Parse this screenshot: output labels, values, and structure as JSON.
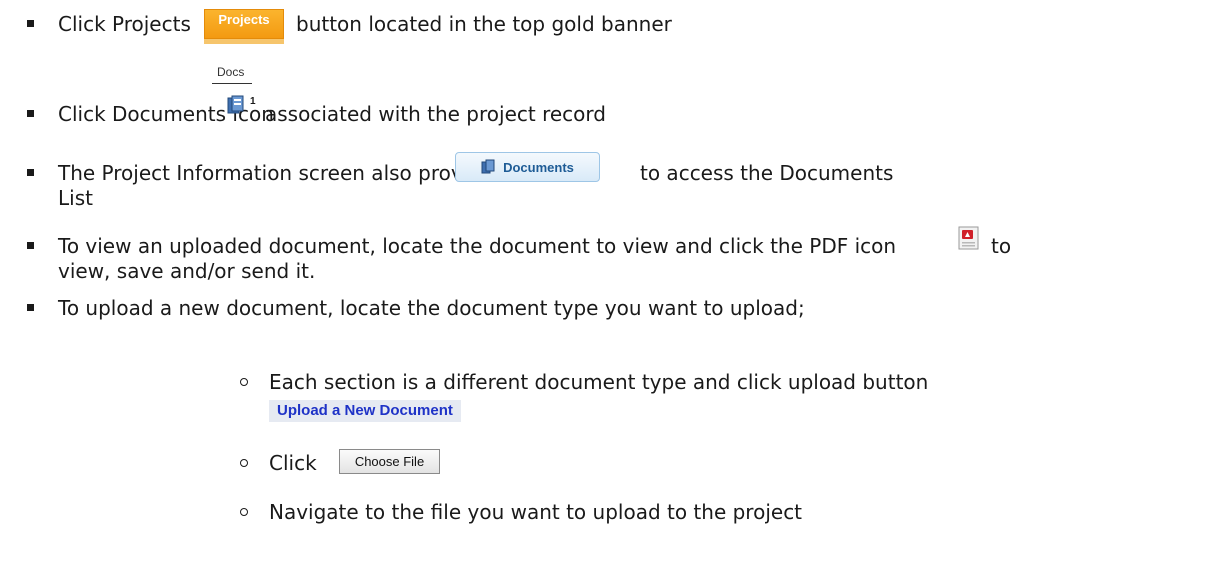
{
  "items": [
    {
      "pre": "Click Projects",
      "post": "button located in the top gold banner"
    },
    {
      "pre": "Click Documents icon",
      "post": "associated with the project record"
    },
    {
      "pre": "The Project Information screen also provides a button",
      "post": "to access the Documents",
      "line2": "List"
    },
    {
      "pre": "To view an uploaded document, locate the document to view and click the PDF icon",
      "post": "to",
      "line2": "view, save and/or send it."
    },
    {
      "pre": "To upload a new document, locate the document type you want to upload;"
    }
  ],
  "subitems": [
    {
      "text": "Each section is a different document type and click upload button"
    },
    {
      "text": "Click"
    },
    {
      "text": "Navigate to the file you want to upload to the project"
    }
  ],
  "buttons": {
    "projects": "Projects",
    "docs_label": "Docs",
    "docs_count": "1",
    "documents": "Documents",
    "upload": "Upload a New Document",
    "choose_file": "Choose File"
  },
  "colors": {
    "projects_bg": "#f6a51f",
    "documents_text": "#1e5c96",
    "upload_text": "#1f33c7"
  },
  "icons": [
    "documents-icon",
    "pdf-icon"
  ]
}
